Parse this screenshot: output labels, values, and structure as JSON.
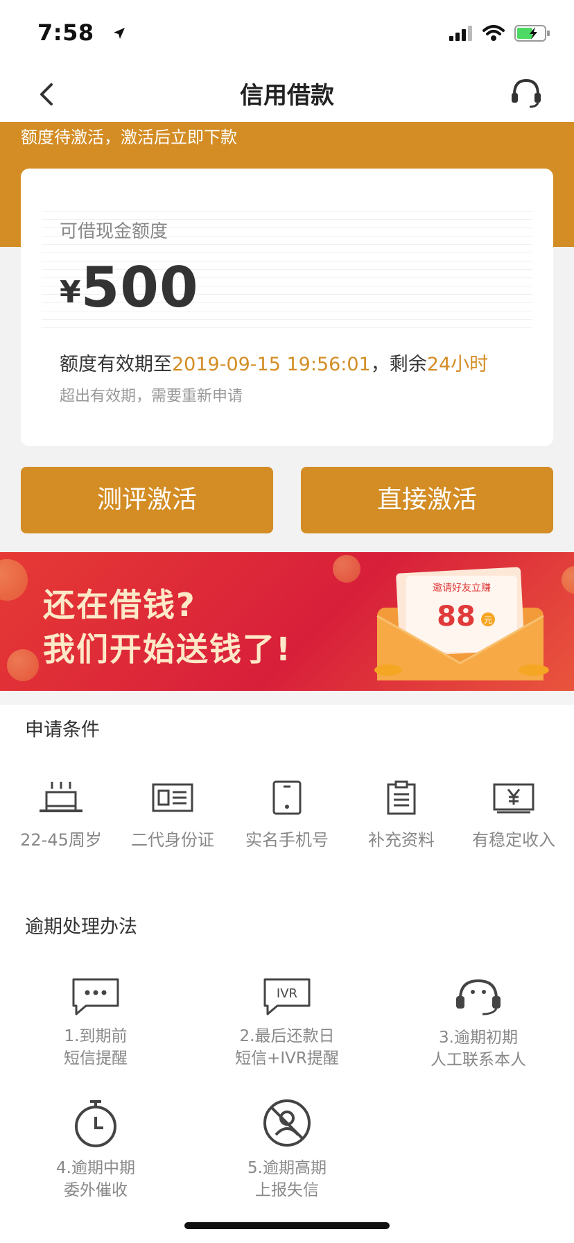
{
  "status_bar": {
    "time": "7:58"
  },
  "nav": {
    "title": "信用借款"
  },
  "header": {
    "activation_notice": "额度待激活，激活后立即下款"
  },
  "limit_card": {
    "label": "可借现金额度",
    "currency": "¥",
    "amount": "500",
    "valid_prefix": "额度有效期至",
    "valid_until": "2019-09-15 19:56:01",
    "remain_prefix": "，剩余",
    "remain_time": "24小时",
    "expiry_note": "超出有效期，需要重新申请"
  },
  "actions": {
    "evaluate_activate": "测评激活",
    "direct_activate": "直接激活"
  },
  "banner": {
    "line1": "还在借钱?",
    "line2": "我们开始送钱了!",
    "envelope_caption": "邀请好友立赚",
    "envelope_amount": "88",
    "envelope_unit": "元"
  },
  "conditions": {
    "title": "申请条件",
    "items": [
      {
        "label": "22-45周岁",
        "icon": "cake-icon"
      },
      {
        "label": "二代身份证",
        "icon": "id-card-icon"
      },
      {
        "label": "实名手机号",
        "icon": "phone-icon"
      },
      {
        "label": "补充资料",
        "icon": "clipboard-icon"
      },
      {
        "label": "有稳定收入",
        "icon": "yen-icon"
      }
    ]
  },
  "overdue": {
    "title": "逾期处理办法",
    "items": [
      {
        "line1": "1.到期前",
        "line2": "短信提醒",
        "icon": "sms-icon"
      },
      {
        "line1": "2.最后还款日",
        "line2": "短信+IVR提醒",
        "icon": "ivr-icon"
      },
      {
        "line1": "3.逾期初期",
        "line2": "人工联系本人",
        "icon": "headset-icon"
      },
      {
        "line1": "4.逾期中期",
        "line2": "委外催收",
        "icon": "stopwatch-icon"
      },
      {
        "line1": "5.逾期高期",
        "line2": "上报失信",
        "icon": "blocked-user-icon"
      }
    ]
  },
  "colors": {
    "accent": "#d38d24",
    "banner_red": "#dd2a3a"
  }
}
